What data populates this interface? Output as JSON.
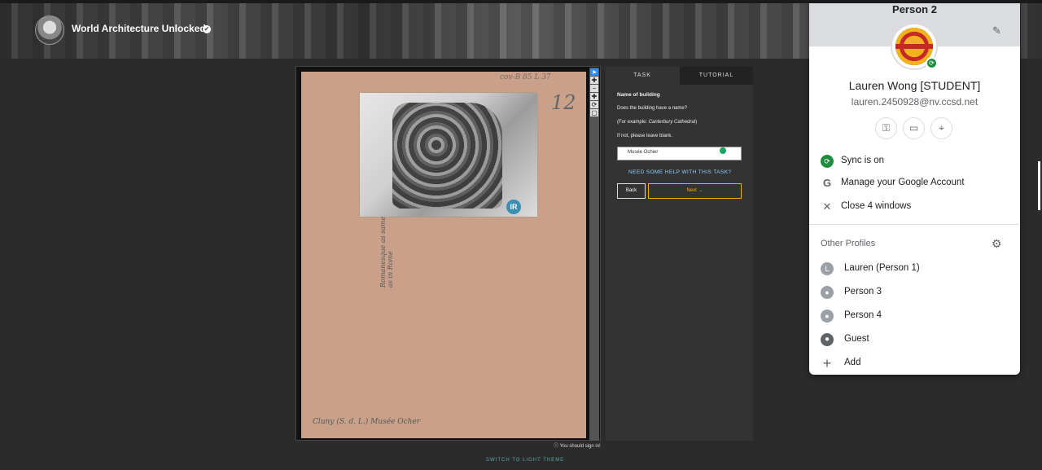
{
  "header": {
    "project_title": "World Architecture Unlocked"
  },
  "viewer": {
    "handwriting_top": "cov-B 85 L 37",
    "handwriting_number": "12",
    "handwriting_side": "Romanesque as same as in Rome",
    "handwriting_bottom": "Cluny (S. d. L.) Musée Ocher",
    "photo_badge": "IR",
    "tools": [
      "➤",
      "✚",
      "−",
      "✚",
      "⟳",
      "▢"
    ],
    "signin_note": "You should sign in!"
  },
  "task": {
    "tabs": [
      "TASK",
      "TUTORIAL"
    ],
    "title": "Name of building",
    "question": "Does the building have a name?",
    "example_prefix": "(For example: ",
    "example_value": "Canterbury Cathedral",
    "example_suffix": ")",
    "instruction": "If not, please leave blank.",
    "input_value": "Musée Ochier",
    "help_link": "NEED SOME HELP WITH THIS TASK?",
    "back_label": "Back",
    "next_label": "Next →"
  },
  "footer": {
    "theme_switch": "SWITCH TO LIGHT THEME"
  },
  "profile_popup": {
    "profile_name": "Person 2",
    "user_name": "Lauren Wong [STUDENT]",
    "user_email": "lauren.2450928@nv.ccsd.net",
    "actions": [
      {
        "label": "Sync is on",
        "icon": "sync-icon"
      },
      {
        "label": "Manage your Google Account",
        "icon": "google-icon"
      },
      {
        "label": "Close 4 windows",
        "icon": "close-icon"
      }
    ],
    "other_profiles_title": "Other Profiles",
    "profiles": [
      {
        "label": "Lauren (Person 1)",
        "icon": "avatar-letter",
        "initial": "L"
      },
      {
        "label": "Person 3",
        "icon": "person-icon"
      },
      {
        "label": "Person 4",
        "icon": "person-icon"
      },
      {
        "label": "Guest",
        "icon": "guest-icon"
      },
      {
        "label": "Add",
        "icon": "plus-icon"
      }
    ],
    "colors": {
      "sync_green": "#1e8e3e",
      "header_gray": "#dadce0"
    }
  }
}
